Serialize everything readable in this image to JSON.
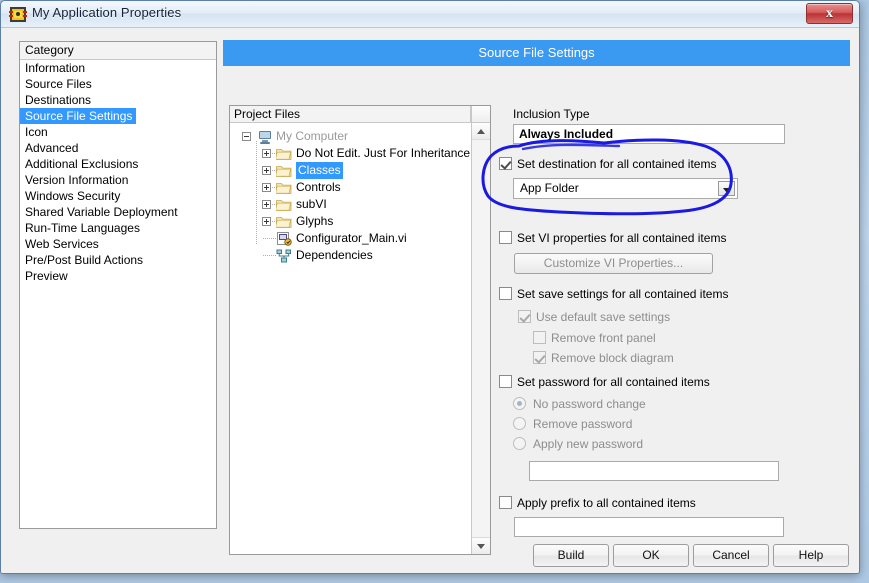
{
  "window": {
    "title": "My Application Properties",
    "icon": "labview-icon",
    "close_label": "✕"
  },
  "category": {
    "header": "Category",
    "items": [
      {
        "label": "Information",
        "selected": false
      },
      {
        "label": "Source Files",
        "selected": false
      },
      {
        "label": "Destinations",
        "selected": false
      },
      {
        "label": "Source File Settings",
        "selected": true
      },
      {
        "label": "Icon",
        "selected": false
      },
      {
        "label": "Advanced",
        "selected": false
      },
      {
        "label": "Additional Exclusions",
        "selected": false
      },
      {
        "label": "Version Information",
        "selected": false
      },
      {
        "label": "Windows Security",
        "selected": false
      },
      {
        "label": "Shared Variable Deployment",
        "selected": false
      },
      {
        "label": "Run-Time Languages",
        "selected": false
      },
      {
        "label": "Web Services",
        "selected": false
      },
      {
        "label": "Pre/Post Build Actions",
        "selected": false
      },
      {
        "label": "Preview",
        "selected": false
      }
    ]
  },
  "section_header": "Source File Settings",
  "tree": {
    "header": "Project Files",
    "root": {
      "label": "My Computer",
      "icon": "computer-icon",
      "expander": "minus"
    },
    "nodes": [
      {
        "label": "Do Not Edit. Just For Inheritance",
        "icon": "folder-icon",
        "expander": "plus",
        "selected": false
      },
      {
        "label": "Classes",
        "icon": "folder-icon",
        "expander": "plus",
        "selected": true
      },
      {
        "label": "Controls",
        "icon": "folder-icon",
        "expander": "plus",
        "selected": false
      },
      {
        "label": "subVI",
        "icon": "folder-icon",
        "expander": "plus",
        "selected": false
      },
      {
        "label": "Glyphs",
        "icon": "folder-icon",
        "expander": "plus",
        "selected": false
      },
      {
        "label": "Configurator_Main.vi",
        "icon": "vi-icon",
        "expander": "none",
        "selected": false
      },
      {
        "label": "Dependencies",
        "icon": "dependencies-icon",
        "expander": "none",
        "selected": false
      }
    ]
  },
  "settings": {
    "inclusion_type_label": "Inclusion Type",
    "inclusion_type_value": "Always Included",
    "set_destination_label": "Set destination for all contained items",
    "set_destination_checked": true,
    "destination_value": "App Folder",
    "set_vi_properties_label": "Set VI properties for all contained items",
    "customize_vi_properties_label": "Customize VI Properties...",
    "set_save_settings_label": "Set save settings for all contained items",
    "use_default_save_label": "Use default save settings",
    "remove_front_panel_label": "Remove front panel",
    "remove_block_diagram_label": "Remove block diagram",
    "set_password_label": "Set password for all contained items",
    "no_password_change_label": "No password change",
    "remove_password_label": "Remove password",
    "apply_new_password_label": "Apply new password",
    "password_value": "",
    "apply_prefix_label": "Apply prefix to all contained items",
    "prefix_value": ""
  },
  "buttons": {
    "build": "Build",
    "ok": "OK",
    "cancel": "Cancel",
    "help": "Help"
  },
  "colors": {
    "header_blue": "#3a99f0",
    "selection_blue": "#3399ff",
    "annotation_blue": "#1a1ae0",
    "dialog_bg": "#f0f0f0"
  }
}
